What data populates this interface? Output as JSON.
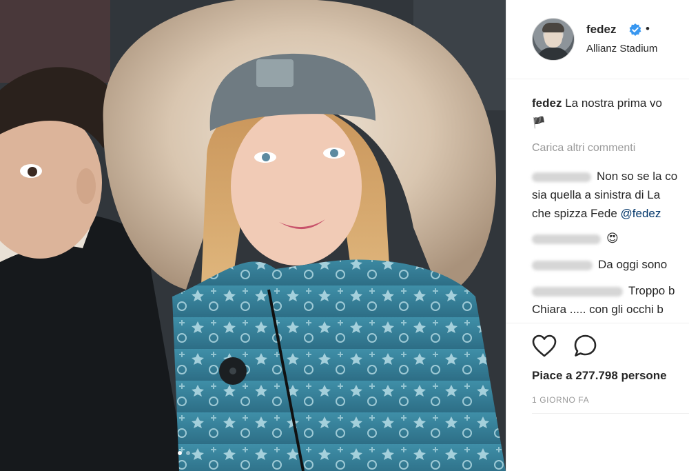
{
  "header": {
    "username": "fedez",
    "bullet": "•",
    "location": "Allianz Stadium"
  },
  "caption": {
    "author": "fedez",
    "text": "La nostra prima vo",
    "emoji": "🏴"
  },
  "load_more": "Carica altri commenti",
  "comments": [
    {
      "line1": "Non so se la co",
      "line2": "sia quella a sinistra di La",
      "line3_prefix": "che spizza Fede ",
      "mention": "@fedez"
    },
    {
      "text": "😍"
    },
    {
      "text": "Da oggi sono"
    },
    {
      "line1": "Troppo b",
      "line2": "Chiara ..... con gli occhi b"
    }
  ],
  "actions": {
    "heart_icon": "heart-outline-icon",
    "comment_icon": "comment-bubble-icon",
    "likes": "Piace a 277.798 persone",
    "timestamp": "1 GIORNO FA"
  },
  "colors": {
    "verified_blue": "#3897f0",
    "muted_text": "#999999",
    "mention": "#003569"
  }
}
